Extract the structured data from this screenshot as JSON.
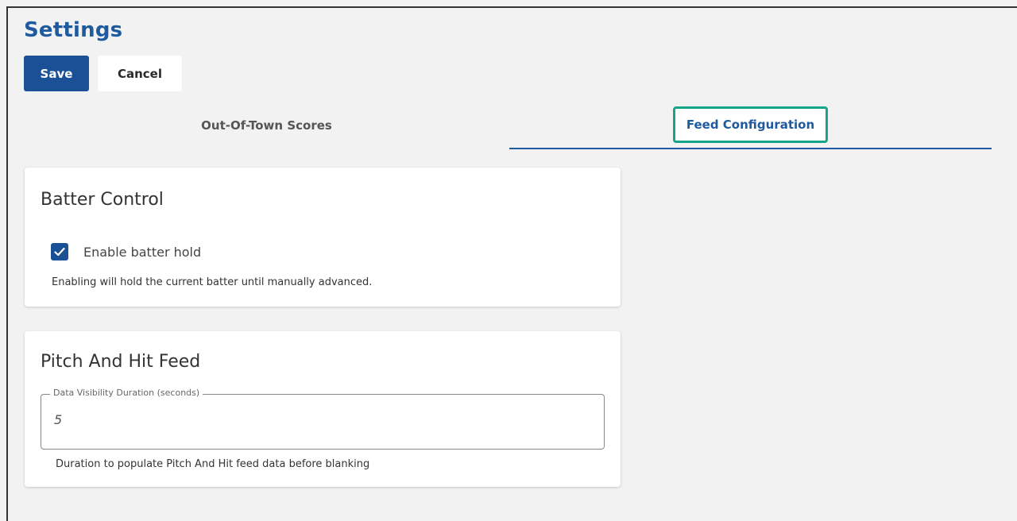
{
  "header": {
    "title": "Settings"
  },
  "toolbar": {
    "save_label": "Save",
    "cancel_label": "Cancel"
  },
  "tabs": [
    {
      "label": "Out-Of-Town Scores",
      "selected": false
    },
    {
      "label": "Feed Configuration",
      "selected": true
    }
  ],
  "batter_control": {
    "title": "Batter Control",
    "checkbox_label": "Enable batter hold",
    "checked": true,
    "helper": "Enabling will hold the current batter until manually advanced."
  },
  "pitch_hit_feed": {
    "title": "Pitch And Hit Feed",
    "field_label": "Data Visibility Duration (seconds)",
    "field_value": "5",
    "helper": "Duration to populate Pitch And Hit feed data before blanking"
  },
  "colors": {
    "primary": "#1a5196",
    "title": "#1f5a9e",
    "focus_outline": "#17a589",
    "background": "#f2f2f2"
  },
  "icons": {
    "checkbox": "check-icon"
  }
}
